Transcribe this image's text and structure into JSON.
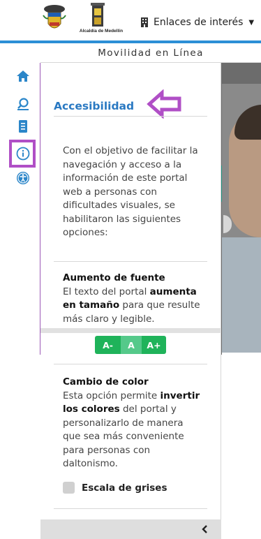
{
  "header": {
    "logo_caption": "Alcaldía de Medellín",
    "links_menu_label": "Enlaces de interés",
    "subtitle": "Movilidad en Línea"
  },
  "rail": {
    "items": [
      {
        "icon": "home-icon"
      },
      {
        "icon": "search-location-icon"
      },
      {
        "icon": "document-icon"
      },
      {
        "icon": "info-icon"
      },
      {
        "icon": "accessibility-icon"
      }
    ]
  },
  "panel": {
    "title": "Accesibilidad",
    "intro": "Con el objetivo de facilitar la navegación y acceso a la información de este portal web a personas con dificultades visuales, se habilitaron las siguientes opciones:",
    "font_section": {
      "title": "Aumento de fuente",
      "text_1": "El texto del portal ",
      "text_bold": "aumenta en tamaño",
      "text_2": " para que resulte más claro y legible.",
      "buttons": {
        "decrease": "A-",
        "normal": "A",
        "increase": "A+"
      }
    },
    "color_section": {
      "title": "Cambio de color",
      "text_1": "Esta opción permite ",
      "text_bold": "invertir los colores",
      "text_2": " del portal y personalizarlo de manera que sea más conveniente para personas con daltonismo.",
      "checkbox_label": "Escala de grises",
      "checkbox_checked": false
    },
    "collapse_icon": "chevron-left-icon"
  },
  "colors": {
    "accent_blue": "#2a79c2",
    "highlight_purple": "#b04fc6",
    "green_button": "#1fb35a"
  }
}
